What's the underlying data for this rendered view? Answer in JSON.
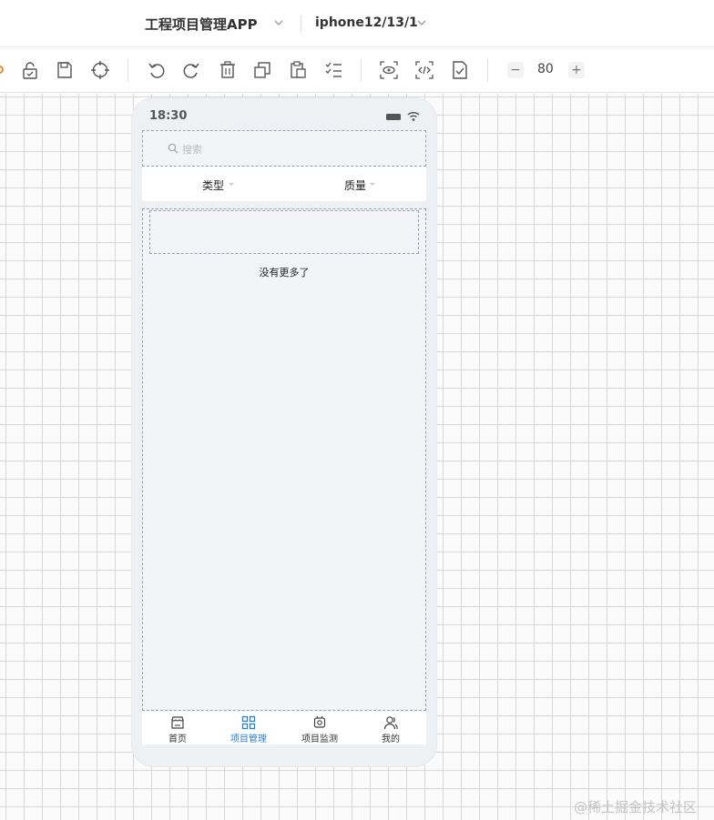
{
  "header": {
    "project_title": "工程项目管理APP",
    "device": "iphone12/13/1"
  },
  "toolbar": {
    "zoom_minus": "−",
    "zoom_value": "80",
    "zoom_plus": "+"
  },
  "phone": {
    "status_time": "18:30",
    "search_placeholder": "搜索",
    "filters": [
      "类型",
      "质量"
    ],
    "empty_text": "没有更多了",
    "tabs": [
      {
        "label": "首页",
        "icon": "store-icon"
      },
      {
        "label": "项目管理",
        "icon": "grid-icon",
        "active": true
      },
      {
        "label": "项目监测",
        "icon": "monitor-icon"
      },
      {
        "label": "我的",
        "icon": "user-icon"
      }
    ]
  },
  "colors": {
    "accent": "#2a7fd4",
    "brand_orange": "#f08a24"
  },
  "watermark": "@稀土掘金技术社区"
}
